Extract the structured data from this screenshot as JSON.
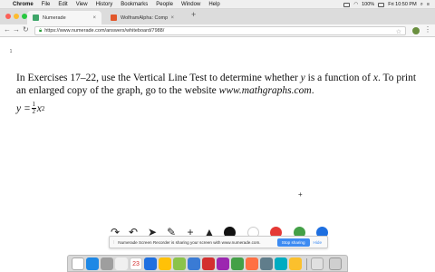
{
  "menubar": {
    "app": "Chrome",
    "items": [
      "File",
      "Edit",
      "View",
      "History",
      "Bookmarks",
      "People",
      "Window",
      "Help"
    ],
    "battery": "100%",
    "clock": "Fri 10:50 PM"
  },
  "tabs": [
    {
      "label": "Numerade",
      "active": true,
      "favicon_color": "#3fa66a"
    },
    {
      "label": "WolframAlpha: Computational",
      "active": false,
      "favicon_color": "#e2572b"
    }
  ],
  "address": {
    "url": "https://www.numerade.com/answers/whiteboard/7988/"
  },
  "page": {
    "page_number": "1",
    "problem_text": "In Exercises 17–22, use the Vertical Line Test to determine whether y is a function of x. To print an enlarged copy of the graph, go to the website www.mathgraphs.com.",
    "equation": {
      "lhs": "y = ",
      "numerator": "1",
      "denominator": "2",
      "var": "x",
      "exponent": "2"
    },
    "cursor_glyph": "+"
  },
  "toolbar": {
    "tools": [
      {
        "name": "redo-icon",
        "glyph": "↷"
      },
      {
        "name": "undo-icon",
        "glyph": "↶"
      },
      {
        "name": "select-icon",
        "glyph": "➤"
      },
      {
        "name": "pen-icon",
        "glyph": "✎"
      },
      {
        "name": "add-icon",
        "glyph": "+"
      },
      {
        "name": "shape-icon",
        "glyph": "▲"
      }
    ],
    "colors": [
      "#111111",
      "#ffffff",
      "#e53935",
      "#43a047",
      "#1e6fe0"
    ]
  },
  "share_banner": {
    "message": "Numerade Screen Recorder is sharing your screen with www.numerade.com.",
    "stop_label": "Stop sharing",
    "hide_label": "Hide"
  },
  "dock": {
    "calendar_day": "23",
    "icons": [
      "#ffffff",
      "#1e88e5",
      "#9e9e9e",
      "#f0f0f0",
      "#1e6fe0",
      "#ffc107",
      "#8bc34a",
      "#3a7bd5",
      "#d32f2f",
      "#9c27b0",
      "#43a047",
      "#ff7043",
      "#607d8b",
      "#00acc1",
      "#fbc02d",
      "#e91e63",
      "#616161",
      "#26a69a",
      "#e53935",
      "#2e7d32",
      "#1565c0",
      "#795548",
      "#c62828",
      "#aaaaaa"
    ]
  }
}
